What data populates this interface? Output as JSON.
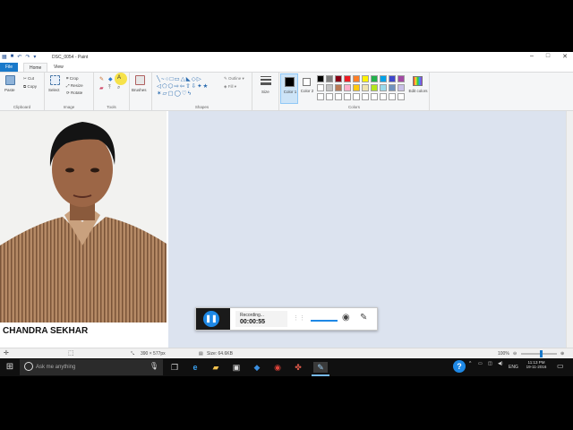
{
  "window": {
    "title": "DSC_0054 - Paint"
  },
  "tabs": [
    {
      "id": "file",
      "label": "File"
    },
    {
      "id": "home",
      "label": "Home"
    },
    {
      "id": "view",
      "label": "View"
    }
  ],
  "ribbon": {
    "clipboard": {
      "paste": "Paste",
      "cut": "Cut",
      "copy": "Copy",
      "group": "Clipboard"
    },
    "image": {
      "select": "Select",
      "crop": "Crop",
      "resize": "Resize",
      "rotate": "Rotate",
      "group": "Image"
    },
    "tools": {
      "group": "Tools"
    },
    "brushes": {
      "label": "Brushes"
    },
    "shapes": {
      "outline": "Outline",
      "fill": "Fill",
      "group": "Shapes"
    },
    "size": {
      "label": "Size"
    },
    "color1": {
      "label": "Color 1"
    },
    "color2": {
      "label": "Color 2"
    },
    "colors": {
      "group": "Colors",
      "edit": "Edit colors"
    }
  },
  "palette": [
    "#000000",
    "#7f7f7f",
    "#880015",
    "#ed1c24",
    "#ff7f27",
    "#fff200",
    "#22b14c",
    "#00a2e8",
    "#3f48cc",
    "#a349a4",
    "#ffffff",
    "#c3c3c3",
    "#b97a57",
    "#ffaec9",
    "#ffc90e",
    "#efe4b0",
    "#b5e61d",
    "#99d9ea",
    "#7092be",
    "#c8bfe7",
    "#ffffff",
    "#ffffff",
    "#ffffff",
    "#ffffff",
    "#ffffff",
    "#ffffff",
    "#ffffff",
    "#ffffff",
    "#ffffff",
    "#ffffff"
  ],
  "canvas": {
    "caption": "CHANDRA SEKHAR"
  },
  "status": {
    "dimensions": "390 × 577px",
    "size": "Size: 64.6KB",
    "zoom": "100%",
    "zoom_level": 0.55
  },
  "recorder": {
    "status": "Recording...",
    "time": "00:00:55"
  },
  "taskbar": {
    "search_placeholder": "Ask me anything",
    "language": "ENG",
    "time": "11:13 PM",
    "date": "19-11-2016"
  }
}
